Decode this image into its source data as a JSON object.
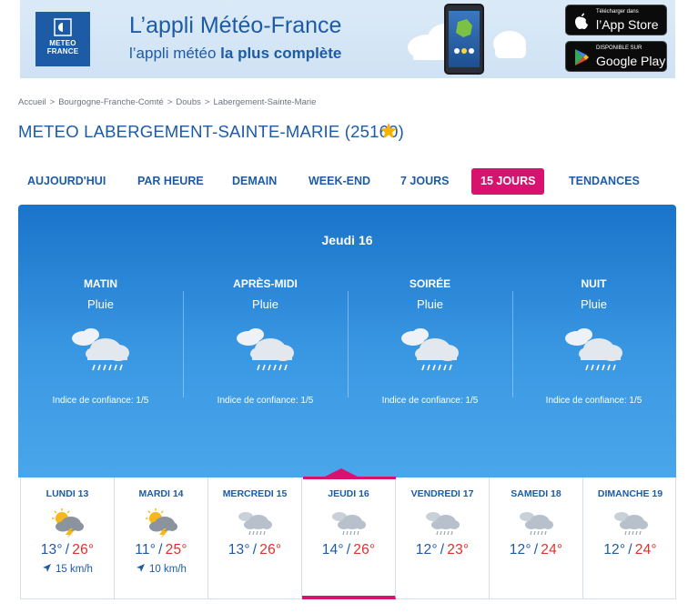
{
  "banner": {
    "logo_line1": "METEO",
    "logo_line2": "FRANCE",
    "title": "L’appli Météo-France",
    "subtitle_prefix": "l’appli météo ",
    "subtitle_bold": "la plus complète",
    "appstore_small": "Télécharger dans",
    "appstore_big": "l’App Store",
    "googleplay_small": "DISPONIBLE SUR",
    "googleplay_big": "Google Play"
  },
  "breadcrumb": [
    "Accueil",
    "Bourgogne-Franche-Comté",
    "Doubs",
    "Labergement-Sainte-Marie"
  ],
  "breadcrumb_sep": ">",
  "page_title": "METEO LABERGEMENT-SAINTE-MARIE (25160)",
  "tabs": [
    {
      "label": "AUJOURD'HUI"
    },
    {
      "label": "PAR HEURE"
    },
    {
      "label": "DEMAIN"
    },
    {
      "label": "WEEK-END"
    },
    {
      "label": "7 JOURS"
    },
    {
      "label": "15 JOURS",
      "active": true
    },
    {
      "label": "TENDANCES"
    }
  ],
  "selected_day": "Jeudi 16",
  "periods": [
    {
      "name": "MATIN",
      "desc": "Pluie",
      "icon": "rain-cloud-icon",
      "confidence": "Indice de confiance: 1/5"
    },
    {
      "name": "APRÈS-MIDI",
      "desc": "Pluie",
      "icon": "rain-cloud-icon",
      "confidence": "Indice de confiance: 1/5"
    },
    {
      "name": "SOIRÉE",
      "desc": "Pluie",
      "icon": "rain-cloud-icon",
      "confidence": "Indice de confiance: 1/5"
    },
    {
      "name": "NUIT",
      "desc": "Pluie",
      "icon": "rain-cloud-icon",
      "confidence": "Indice de confiance: 1/5"
    }
  ],
  "days": [
    {
      "name": "LUNDI 13",
      "icon": "thunderstorm-sun-icon",
      "tmin": "13°",
      "tmax": "26°",
      "wind": "15",
      "wind_unit": "km/h"
    },
    {
      "name": "MARDI 14",
      "icon": "thunderstorm-sun-icon",
      "tmin": "11°",
      "tmax": "25°",
      "wind": "10",
      "wind_unit": "km/h"
    },
    {
      "name": "MERCREDI 15",
      "icon": "rain-cloud-icon",
      "tmin": "13°",
      "tmax": "26°"
    },
    {
      "name": "JEUDI 16",
      "icon": "rain-cloud-icon",
      "tmin": "14°",
      "tmax": "26°",
      "active": true
    },
    {
      "name": "VENDREDI 17",
      "icon": "rain-cloud-icon",
      "tmin": "12°",
      "tmax": "23°"
    },
    {
      "name": "SAMEDI 18",
      "icon": "rain-cloud-icon",
      "tmin": "12°",
      "tmax": "24°"
    },
    {
      "name": "DIMANCHE 19",
      "icon": "rain-cloud-icon",
      "tmin": "12°",
      "tmax": "24°"
    }
  ],
  "temp_separator": "/",
  "colors": {
    "brand_blue": "#1d5ba6",
    "accent_pink": "#d6136f",
    "tmax_red": "#e0302c",
    "panel_blue": "#1a73c9"
  }
}
